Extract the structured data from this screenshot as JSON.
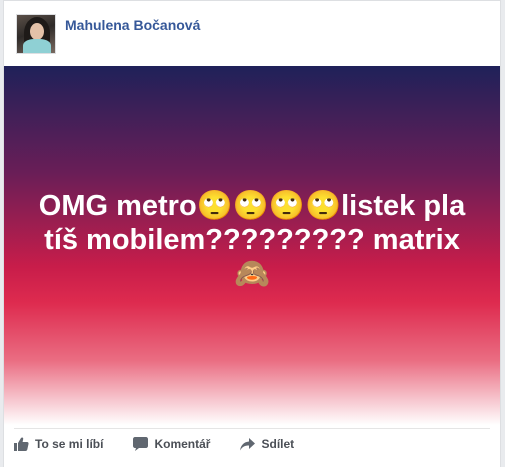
{
  "author": {
    "name": "Mahulena Bočanová"
  },
  "post": {
    "text": "OMG metro🙄🙄🙄🙄listek platíš mobilem????????? matrix🙈"
  },
  "actions": [
    {
      "label": "To se mi líbí",
      "icon": "like-icon"
    },
    {
      "label": "Komentář",
      "icon": "comment-icon"
    },
    {
      "label": "Sdílet",
      "icon": "share-icon"
    }
  ],
  "colors": {
    "author_link": "#365899",
    "action_text": "#4b4f56",
    "gradient_top": "#1f2159",
    "gradient_mid": "#de2b4f"
  }
}
